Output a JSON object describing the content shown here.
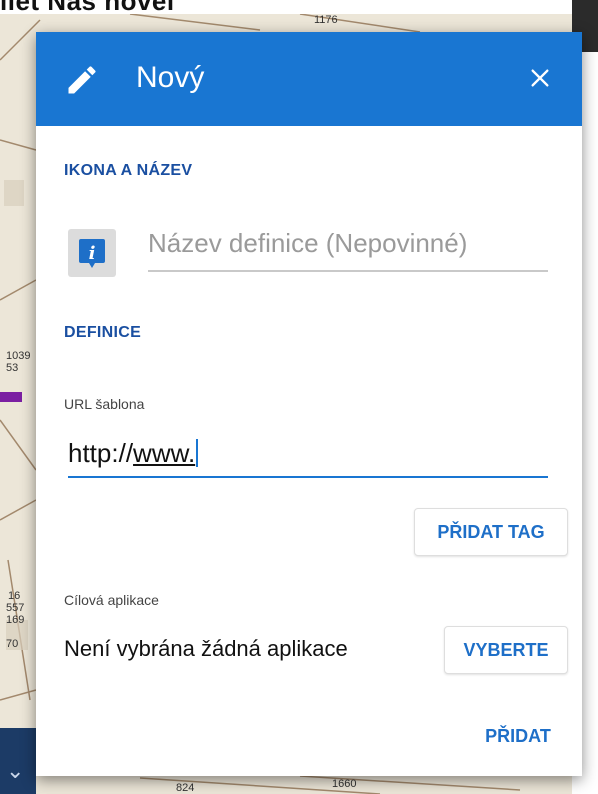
{
  "background": {
    "header_text": "ilet Naš novel",
    "map_labels": [
      "1176",
      "1039",
      "53",
      "16",
      "557",
      "169",
      "70",
      "1660",
      "824"
    ]
  },
  "dialog": {
    "title": "Nový",
    "header_icon": "pencil-icon",
    "close_icon": "close-icon",
    "accent_color": "#1976d2",
    "section_icon_name": {
      "title": "IKONA A NÁZEV",
      "icon": "info-marker-icon",
      "name_placeholder": "Název definice (Nepovinné)"
    },
    "section_definition": {
      "title": "DEFINICE",
      "url_label": "URL šablona",
      "url_prefix": "http://",
      "url_underlined": "www.",
      "add_tag_button": "PŘIDAT TAG"
    },
    "target_app": {
      "label": "Cílová aplikace",
      "value": "Není vybrána žádná aplikace",
      "select_button": "VYBERTE"
    },
    "add_button": "PŘIDAT"
  }
}
